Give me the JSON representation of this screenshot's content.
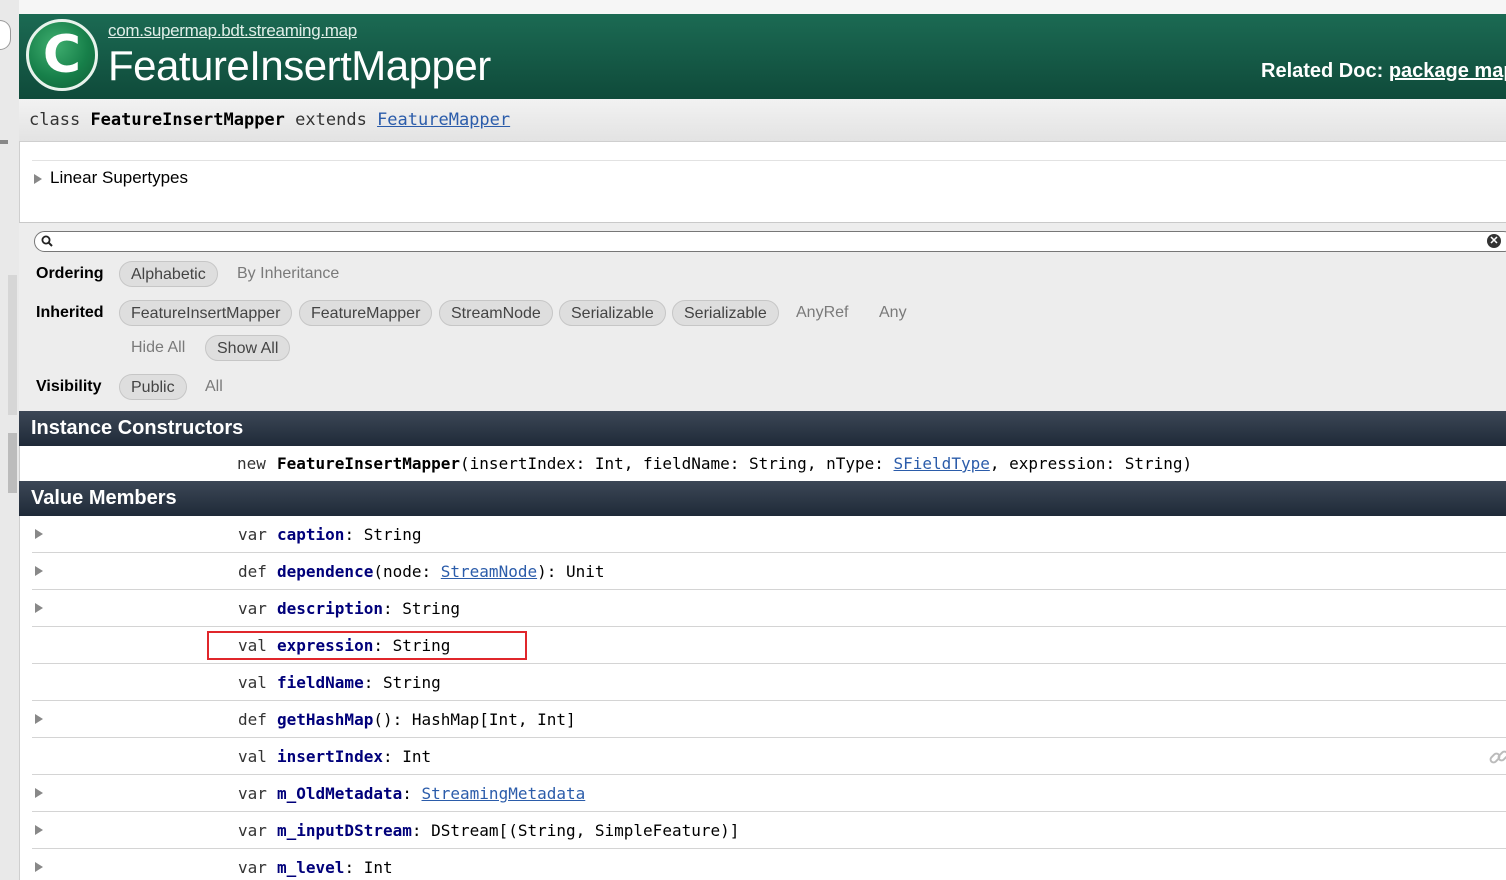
{
  "header": {
    "package_path": "com.supermap.bdt.streaming.map",
    "title": "FeatureInsertMapper",
    "logo_letter": "C",
    "related_doc_label": "Related Doc:",
    "related_doc_link": "package map"
  },
  "signature": {
    "keyword": "class",
    "name": "FeatureInsertMapper",
    "extends_keyword": "extends",
    "parent": "FeatureMapper"
  },
  "supertypes": {
    "label": "Linear Supertypes"
  },
  "filter": {
    "search_value": "",
    "ordering_label": "Ordering",
    "ordering_options": [
      "Alphabetic",
      "By Inheritance"
    ],
    "inherited_label": "Inherited",
    "inherited_options": [
      "FeatureInsertMapper",
      "FeatureMapper",
      "StreamNode",
      "Serializable",
      "Serializable",
      "AnyRef",
      "Any"
    ],
    "hide_all": "Hide All",
    "show_all": "Show All",
    "visibility_label": "Visibility",
    "visibility_options": [
      "Public",
      "All"
    ]
  },
  "constructors": {
    "title": "Instance Constructors",
    "keyword": "new",
    "name": "FeatureInsertMapper",
    "params_a": "(insertIndex: Int, fieldName: String, nType: ",
    "param_type_link": "SFieldType",
    "params_b": ", expression: String)"
  },
  "value_members": {
    "title": "Value Members",
    "rows": [
      {
        "kw": "var",
        "name": "caption",
        "pre": ": String",
        "link": "",
        "post": ""
      },
      {
        "kw": "def",
        "name": "dependence",
        "pre": "(node: ",
        "link": "StreamNode",
        "post": "): Unit"
      },
      {
        "kw": "var",
        "name": "description",
        "pre": ": String",
        "link": "",
        "post": ""
      },
      {
        "kw": "val",
        "name": "expression",
        "pre": ": String",
        "link": "",
        "post": ""
      },
      {
        "kw": "val",
        "name": "fieldName",
        "pre": ": String",
        "link": "",
        "post": ""
      },
      {
        "kw": "def",
        "name": "getHashMap",
        "pre": "(): HashMap[Int, Int]",
        "link": "",
        "post": ""
      },
      {
        "kw": "val",
        "name": "insertIndex",
        "pre": ": Int",
        "link": "",
        "post": ""
      },
      {
        "kw": "var",
        "name": "m_OldMetadata",
        "pre": ": ",
        "link": "StreamingMetadata",
        "post": ""
      },
      {
        "kw": "var",
        "name": "m_inputDStream",
        "pre": ": DStream[(String, SimpleFeature)]",
        "link": "",
        "post": ""
      },
      {
        "kw": "var",
        "name": "m_level",
        "pre": ": Int",
        "link": "",
        "post": ""
      }
    ]
  },
  "icons": {
    "logo": "class-c-icon",
    "search": "search-icon",
    "clear": "clear-icon",
    "expand": "expand-arrow-icon",
    "permalink": "link-icon"
  },
  "colors": {
    "header_green": "#165c48",
    "section_dark": "#2a3543",
    "member_name": "#00007a",
    "link_blue": "#2b5caa",
    "highlight_red": "#e0262b"
  }
}
